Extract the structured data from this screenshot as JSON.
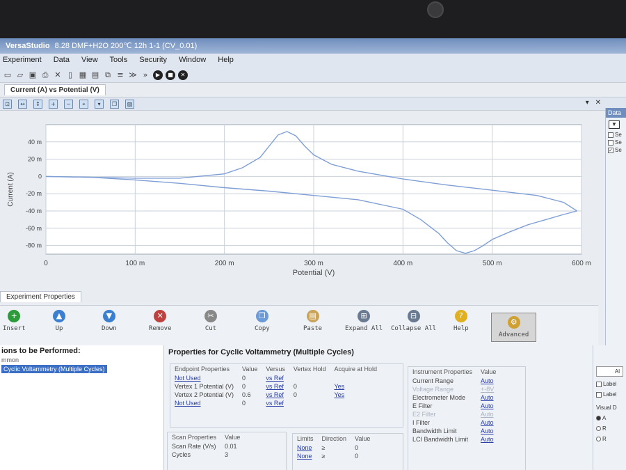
{
  "window": {
    "app_name": "VersaStudio",
    "file_title": "8.28 DMF+H2O 200℃ 12h 1-1 (CV_0.01)"
  },
  "menu": [
    "Experiment",
    "Data",
    "View",
    "Tools",
    "Security",
    "Window",
    "Help"
  ],
  "toolbar_icons": [
    "new-icon",
    "open-icon",
    "save-icon",
    "print-icon",
    "delete-icon",
    "folder-icon",
    "chart-icon",
    "table-icon",
    "overlay-icon",
    "list-icon",
    "forward-icon",
    "fast-forward-icon",
    "run-icon",
    "stop-icon",
    "abort-icon"
  ],
  "graph_tab": "Current (A) vs Potential (V)",
  "data_panel": {
    "tab": "Data",
    "filter_glyph": "▼",
    "items": [
      "Se",
      "Se",
      "Se"
    ]
  },
  "chart_data": {
    "type": "line",
    "title": "",
    "xlabel": "Potential (V)",
    "ylabel": "Current (A)",
    "xlim": [
      0,
      0.6
    ],
    "ylim": [
      -0.09,
      0.06
    ],
    "x_ticks": [
      0,
      0.1,
      0.2,
      0.3,
      0.4,
      0.5,
      0.6
    ],
    "x_tick_labels": [
      "0",
      "100 m",
      "200 m",
      "300 m",
      "400 m",
      "500 m",
      "600 m"
    ],
    "y_ticks": [
      0.04,
      0.02,
      0,
      -0.02,
      -0.04,
      -0.06,
      -0.08
    ],
    "y_tick_labels": [
      "40 m",
      "20 m",
      "0",
      "-20 m",
      "-40 m",
      "-60 m",
      "-80 m"
    ],
    "grid": true,
    "line_color": "#7f9fd6",
    "series": [
      {
        "x": [
          0.0,
          0.05,
          0.1,
          0.15,
          0.2,
          0.22,
          0.24,
          0.25,
          0.26,
          0.27,
          0.28,
          0.29,
          0.3,
          0.32,
          0.35,
          0.4,
          0.45,
          0.5,
          0.55,
          0.58,
          0.595
        ],
        "y": [
          0.0,
          -0.001,
          -0.002,
          -0.002,
          0.003,
          0.01,
          0.022,
          0.035,
          0.048,
          0.052,
          0.047,
          0.035,
          0.025,
          0.014,
          0.006,
          -0.003,
          -0.01,
          -0.016,
          -0.022,
          -0.03,
          -0.04
        ]
      },
      {
        "x": [
          0.595,
          0.58,
          0.56,
          0.54,
          0.52,
          0.5,
          0.49,
          0.48,
          0.47,
          0.46,
          0.45,
          0.44,
          0.42,
          0.4,
          0.35,
          0.3,
          0.25,
          0.2,
          0.15,
          0.1,
          0.05,
          0.0
        ],
        "y": [
          -0.04,
          -0.044,
          -0.05,
          -0.056,
          -0.064,
          -0.073,
          -0.08,
          -0.086,
          -0.089,
          -0.086,
          -0.077,
          -0.066,
          -0.05,
          -0.038,
          -0.027,
          -0.022,
          -0.017,
          -0.013,
          -0.008,
          -0.004,
          -0.001,
          0.0
        ]
      }
    ]
  },
  "properties_tab": "Experiment Properties",
  "prop_toolbar": [
    {
      "label": "Insert",
      "color": "#2e9b3a",
      "glyph": "+"
    },
    {
      "label": "Up",
      "color": "#3a7fd0",
      "glyph": "▲"
    },
    {
      "label": "Down",
      "color": "#3a7fd0",
      "glyph": "▼"
    },
    {
      "label": "Remove",
      "color": "#c04040",
      "glyph": "✕"
    },
    {
      "label": "Cut",
      "color": "#888888",
      "glyph": "✂"
    },
    {
      "label": "Copy",
      "color": "#6a9ad8",
      "glyph": "❐"
    },
    {
      "label": "Paste",
      "color": "#c9a45a",
      "glyph": "▤"
    },
    {
      "label": "Expand All",
      "color": "#6a7a90",
      "glyph": "⊞"
    },
    {
      "label": "Collapse All",
      "color": "#6a7a90",
      "glyph": "⊟"
    },
    {
      "label": "Help",
      "color": "#e0b020",
      "glyph": "?"
    },
    {
      "label": "Advanced",
      "color": "#d0a030",
      "glyph": "⚙"
    }
  ],
  "operations": {
    "title": "ions to be Performed:",
    "sub": "mmon",
    "selected": "Cyclic Voltammetry (Multiple Cycles)"
  },
  "properties_title": "Properties for Cyclic Voltammetry (Multiple Cycles)",
  "endpoint": {
    "headers": [
      "Endpoint Properties",
      "Value",
      "Versus",
      "Vertex Hold",
      "Acquire at Hold"
    ],
    "rows": [
      [
        "Not Used",
        "0",
        "vs Ref",
        "",
        ""
      ],
      [
        "Vertex 1 Potential (V)",
        "0",
        "vs Ref",
        "0",
        "Yes"
      ],
      [
        "Vertex 2 Potential (V)",
        "0.6",
        "vs Ref",
        "0",
        "Yes"
      ],
      [
        "Not Used",
        "0",
        "vs Ref",
        "",
        ""
      ]
    ]
  },
  "scan": {
    "headers": [
      "Scan Properties",
      "Value"
    ],
    "rows": [
      [
        "Scan Rate (V/s)",
        "0.01"
      ],
      [
        "Cycles",
        "3"
      ]
    ]
  },
  "limits": {
    "headers": [
      "Limits",
      "Direction",
      "Value"
    ],
    "rows": [
      [
        "None",
        "≥",
        "0"
      ],
      [
        "None",
        "≥",
        "0"
      ]
    ]
  },
  "instrument": {
    "headers": [
      "Instrument Properties",
      "Value"
    ],
    "rows": [
      [
        "Current Range",
        "Auto",
        false
      ],
      [
        "Voltage Range",
        "+-8V",
        true
      ],
      [
        "Electrometer Mode",
        "Auto",
        false
      ],
      [
        "E Filter",
        "Auto",
        false
      ],
      [
        "E2 Filter",
        "Auto",
        true
      ],
      [
        "I Filter",
        "Auto",
        false
      ],
      [
        "Bandwidth Limit",
        "Auto",
        false
      ],
      [
        "LCI Bandwidth Limit",
        "Auto",
        false
      ]
    ]
  },
  "side_panel": {
    "all_btn": "Al",
    "checks": [
      "Label",
      "Label"
    ],
    "visual_label": "Visual D",
    "radios": [
      "A",
      "R",
      "R"
    ]
  }
}
